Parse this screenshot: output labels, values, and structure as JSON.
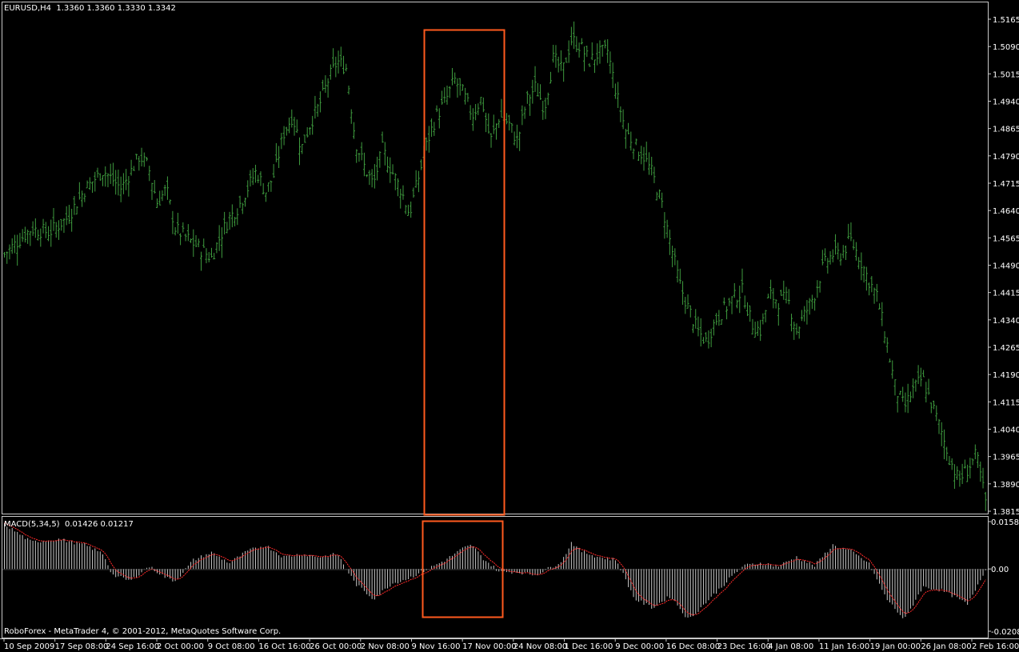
{
  "colors": {
    "background": "#000000",
    "price_bars": "#3e9a3e",
    "frame": "#c8c8c8",
    "macd_histogram": "#c8c8c8",
    "signal_line": "#ff2a2a",
    "highlight_box": "#ff5a1e"
  },
  "main_header": {
    "symbol": "EURUSD,H4",
    "ohlc": "1.3360 1.3360 1.3330 1.3342"
  },
  "macd_header": {
    "name": "MACD(5,34,5)",
    "values": "0.01426 0.01217"
  },
  "copyright": "RoboForex - MetaTrader 4, © 2001-2012, MetaQuotes Software Corp.",
  "chart_data": [
    {
      "type": "bar",
      "subtype": "ohlc",
      "symbol": "EURUSD",
      "timeframe": "H4",
      "ylim": [
        1.3815,
        1.5165
      ],
      "y_ticks": [
        "1.5165",
        "1.5090",
        "1.5015",
        "1.4940",
        "1.4865",
        "1.4790",
        "1.4715",
        "1.4640",
        "1.4565",
        "1.4490",
        "1.4415",
        "1.4340",
        "1.4265",
        "1.4190",
        "1.4115",
        "1.4040",
        "1.3965",
        "1.3890",
        "1.3815"
      ],
      "x_ticks": [
        "10 Sep 2009",
        "17 Sep 08:00",
        "24 Sep 16:00",
        "2 Oct 00:00",
        "9 Oct 08:00",
        "16 Oct 16:00",
        "26 Oct 00:00",
        "2 Nov 08:00",
        "9 Nov 16:00",
        "17 Nov 00:00",
        "24 Nov 08:00",
        "1 Dec 16:00",
        "9 Dec 00:00",
        "16 Dec 08:00",
        "23 Dec 16:00",
        "4 Jan 08:00",
        "11 Jan 16:00",
        "19 Jan 00:00",
        "26 Jan 08:00",
        "2 Feb 16:00"
      ],
      "close_path": [
        [
          0,
          1.452
        ],
        [
          3,
          1.459
        ],
        [
          5,
          1.458
        ],
        [
          7,
          1.462
        ],
        [
          9,
          1.47
        ],
        [
          11,
          1.475
        ],
        [
          13,
          1.47
        ],
        [
          15,
          1.479
        ],
        [
          16,
          1.476
        ],
        [
          17,
          1.466
        ],
        [
          18,
          1.47
        ],
        [
          19,
          1.459
        ],
        [
          21,
          1.455
        ],
        [
          23,
          1.451
        ],
        [
          24,
          1.457
        ],
        [
          25,
          1.462
        ],
        [
          26,
          1.465
        ],
        [
          27,
          1.47
        ],
        [
          28,
          1.475
        ],
        [
          29,
          1.469
        ],
        [
          30,
          1.474
        ],
        [
          31,
          1.485
        ],
        [
          32,
          1.49
        ],
        [
          33,
          1.481
        ],
        [
          34,
          1.488
        ],
        [
          35,
          1.493
        ],
        [
          36,
          1.5
        ],
        [
          37,
          1.505
        ],
        [
          38,
          1.503
        ],
        [
          39,
          1.483
        ],
        [
          40,
          1.476
        ],
        [
          41,
          1.471
        ],
        [
          42,
          1.481
        ],
        [
          43,
          1.475
        ],
        [
          44,
          1.47
        ],
        [
          45,
          1.463
        ],
        [
          46,
          1.473
        ],
        [
          47,
          1.483
        ],
        [
          48,
          1.49
        ],
        [
          49,
          1.494
        ],
        [
          50,
          1.5
        ],
        [
          51,
          1.496
        ],
        [
          52,
          1.49
        ],
        [
          53,
          1.495
        ],
        [
          54,
          1.483
        ],
        [
          55,
          1.49
        ],
        [
          56,
          1.488
        ],
        [
          57,
          1.483
        ],
        [
          58,
          1.494
        ],
        [
          59,
          1.498
        ],
        [
          60,
          1.492
        ],
        [
          61,
          1.506
        ],
        [
          62,
          1.502
        ],
        [
          63,
          1.511
        ],
        [
          64,
          1.509
        ],
        [
          65,
          1.505
        ],
        [
          66,
          1.507
        ],
        [
          67,
          1.508
        ],
        [
          68,
          1.496
        ],
        [
          69,
          1.486
        ],
        [
          70,
          1.482
        ],
        [
          71,
          1.479
        ],
        [
          72,
          1.474
        ],
        [
          73,
          1.466
        ],
        [
          74,
          1.455
        ],
        [
          75,
          1.444
        ],
        [
          76,
          1.437
        ],
        [
          77,
          1.431
        ],
        [
          78,
          1.428
        ],
        [
          79,
          1.434
        ],
        [
          80,
          1.437
        ],
        [
          81,
          1.44
        ],
        [
          82,
          1.442
        ],
        [
          83,
          1.433
        ],
        [
          84,
          1.431
        ],
        [
          85,
          1.441
        ],
        [
          86,
          1.439
        ],
        [
          87,
          1.44
        ],
        [
          88,
          1.431
        ],
        [
          89,
          1.436
        ],
        [
          90,
          1.441
        ],
        [
          91,
          1.449
        ],
        [
          92,
          1.452
        ],
        [
          93,
          1.452
        ],
        [
          94,
          1.456
        ],
        [
          95,
          1.451
        ],
        [
          96,
          1.445
        ],
        [
          97,
          1.44
        ],
        [
          98,
          1.428
        ],
        [
          99,
          1.415
        ],
        [
          100,
          1.41
        ],
        [
          101,
          1.415
        ],
        [
          102,
          1.418
        ],
        [
          103,
          1.411
        ],
        [
          104,
          1.404
        ],
        [
          105,
          1.396
        ],
        [
          106,
          1.39
        ],
        [
          107,
          1.393
        ],
        [
          108,
          1.397
        ],
        [
          109,
          1.3842
        ]
      ],
      "highlight_region": {
        "from": "9 Nov 16:00",
        "to": "24 Nov 08:00"
      }
    },
    {
      "type": "bar",
      "subtype": "macd_histogram",
      "indicator": "MACD(5,34,5)",
      "main_value": 0.01426,
      "signal_value": 0.01217,
      "ylim": [
        -0.02081,
        0.01584
      ],
      "y_ticks": [
        "0.01584",
        "0.00",
        "-0.02081"
      ],
      "values_path": [
        [
          0,
          0.015
        ],
        [
          3,
          0.009
        ],
        [
          6,
          0.01
        ],
        [
          9,
          0.008
        ],
        [
          11,
          0.005
        ],
        [
          12,
          -0.002
        ],
        [
          14,
          -0.004
        ],
        [
          16,
          0.001
        ],
        [
          18,
          -0.003
        ],
        [
          19,
          -0.004
        ],
        [
          21,
          0.003
        ],
        [
          23,
          0.0055
        ],
        [
          25,
          0.002
        ],
        [
          27,
          0.006
        ],
        [
          29,
          0.008
        ],
        [
          31,
          0.004
        ],
        [
          33,
          0.005
        ],
        [
          35,
          0.004
        ],
        [
          37,
          0.005
        ],
        [
          39,
          -0.005
        ],
        [
          41,
          -0.01
        ],
        [
          43,
          -0.005
        ],
        [
          45,
          -0.003
        ],
        [
          47,
          0.0
        ],
        [
          49,
          0.003
        ],
        [
          51,
          0.007
        ],
        [
          52,
          0.008
        ],
        [
          53,
          0.004
        ],
        [
          55,
          -0.001
        ],
        [
          57,
          -0.001
        ],
        [
          59,
          -0.002
        ],
        [
          61,
          0.001
        ],
        [
          62,
          0.003
        ],
        [
          63,
          0.009
        ],
        [
          64,
          0.006
        ],
        [
          66,
          0.004
        ],
        [
          68,
          0.003
        ],
        [
          70,
          -0.01
        ],
        [
          72,
          -0.013
        ],
        [
          74,
          -0.009
        ],
        [
          76,
          -0.017
        ],
        [
          78,
          -0.011
        ],
        [
          80,
          -0.005
        ],
        [
          82,
          0.001
        ],
        [
          84,
          0.002
        ],
        [
          86,
          0.001
        ],
        [
          88,
          0.004
        ],
        [
          90,
          0.001
        ],
        [
          92,
          0.008
        ],
        [
          94,
          0.006
        ],
        [
          96,
          0.002
        ],
        [
          98,
          -0.01
        ],
        [
          100,
          -0.017
        ],
        [
          102,
          -0.006
        ],
        [
          104,
          -0.007
        ],
        [
          106,
          -0.01
        ],
        [
          107,
          -0.012
        ],
        [
          109,
          0.0
        ]
      ]
    }
  ]
}
